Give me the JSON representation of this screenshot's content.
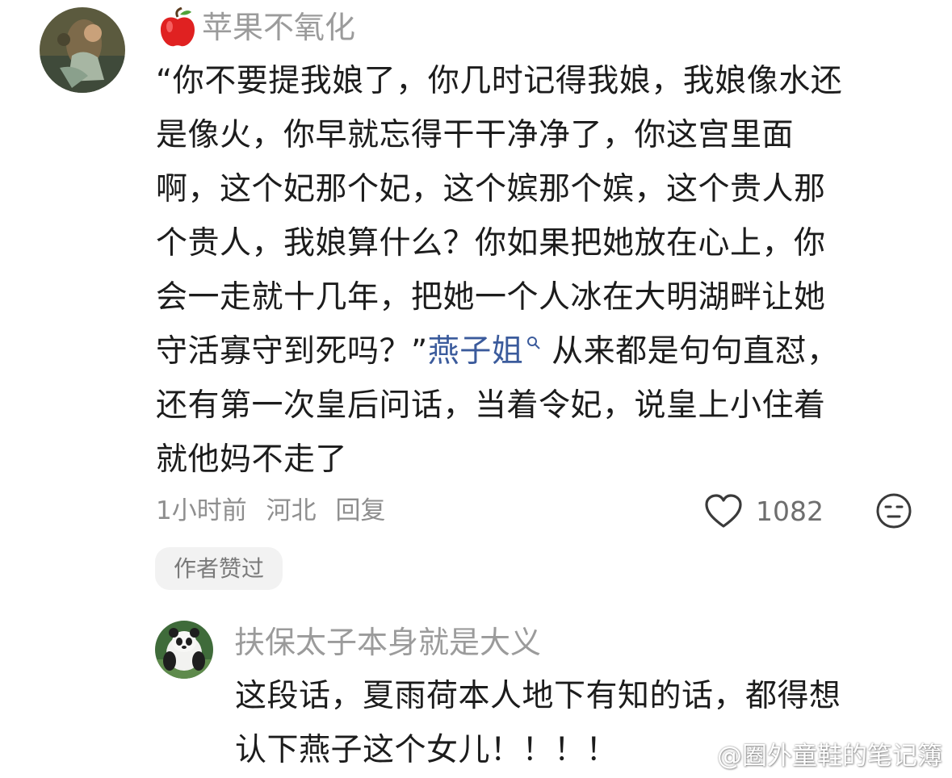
{
  "comment": {
    "username": "苹果不氧化",
    "username_emoji": "apple-emoji",
    "text_lines": [
      "“你不要提我娘了，你几时记得我娘，我娘像水还",
      "是像火，你早就忘得干干净净了，你这宫里面",
      "啊，这个妃那个妃，这个嫔那个嫔，这个贵人那",
      "个贵人，我娘算什么？你如果把她放在心上，你",
      "会一走就十几年，把她一个人冰在大明湖畔让她"
    ],
    "line6_before": "守活寡守到死吗？”",
    "line6_mention": "燕子姐",
    "line6_after": "从来都是句句直怼，",
    "text_lines_end": [
      "还有第一次皇后问话，当着令妃，说皇上小住着",
      "就他妈不走了"
    ],
    "time": "1小时前",
    "location": "河北",
    "reply_label": "回复",
    "like_count": "1082",
    "author_liked_badge": "作者赞过"
  },
  "reply": {
    "username": "扶保太子本身就是大义",
    "text_lines": [
      "这段话，夏雨荷本人地下有知的话，都得想",
      "认下燕子这个女儿！！！！"
    ]
  },
  "watermark": {
    "text": "@圈外童鞋的笔记簿",
    "icon": "weibo-icon"
  },
  "colors": {
    "username": "#9b9b9b",
    "mention": "#3b5b9c",
    "meta": "#8e8e8e",
    "badge_bg": "#f2f2f2"
  }
}
